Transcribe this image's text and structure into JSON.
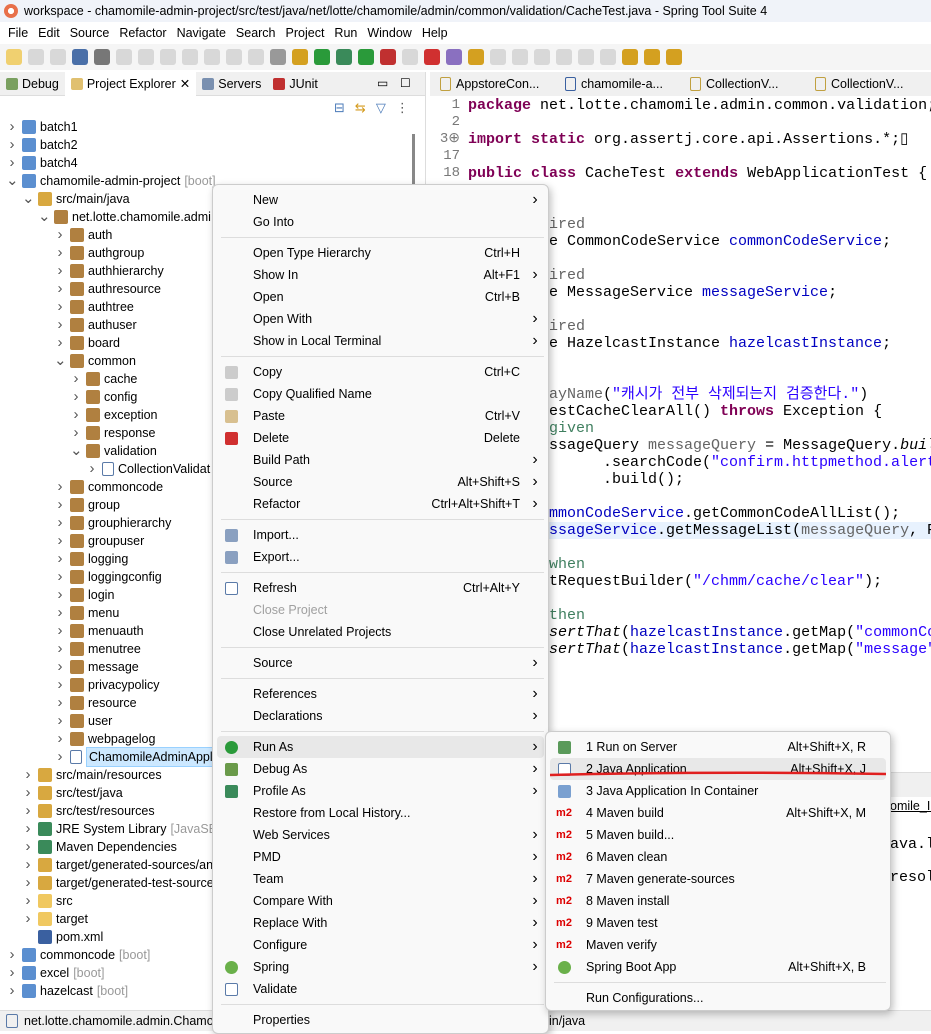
{
  "window": {
    "title": "workspace - chamomile-admin-project/src/test/java/net/lotte/chamomile/admin/common/validation/CacheTest.java - Spring Tool Suite 4"
  },
  "menubar": [
    "File",
    "Edit",
    "Source",
    "Refactor",
    "Navigate",
    "Search",
    "Project",
    "Run",
    "Window",
    "Help"
  ],
  "view_tabs": [
    {
      "label": "Debug",
      "icon": "bug-icon"
    },
    {
      "label": "Project Explorer",
      "icon": "project-explorer-icon",
      "active": true,
      "close": "✕"
    },
    {
      "label": "Servers",
      "icon": "servers-icon"
    },
    {
      "label": "JUnit",
      "icon": "junit-icon"
    }
  ],
  "tree": [
    {
      "label": "batch1",
      "level": 0,
      "arrow": ">",
      "icon": "maven-project"
    },
    {
      "label": "batch2",
      "level": 0,
      "arrow": ">",
      "icon": "maven-project"
    },
    {
      "label": "batch4",
      "level": 0,
      "arrow": ">",
      "icon": "maven-project"
    },
    {
      "label": "chamomile-admin-project",
      "sub": "[boot]",
      "level": 0,
      "arrow": "v",
      "icon": "maven-project"
    },
    {
      "label": "src/main/java",
      "level": 1,
      "arrow": "v",
      "icon": "source-folder"
    },
    {
      "label": "net.lotte.chamomile.admi",
      "level": 2,
      "arrow": "v",
      "icon": "package"
    },
    {
      "label": "auth",
      "level": 3,
      "arrow": ">",
      "icon": "package"
    },
    {
      "label": "authgroup",
      "level": 3,
      "arrow": ">",
      "icon": "package"
    },
    {
      "label": "authhierarchy",
      "level": 3,
      "arrow": ">",
      "icon": "package"
    },
    {
      "label": "authresource",
      "level": 3,
      "arrow": ">",
      "icon": "package"
    },
    {
      "label": "authtree",
      "level": 3,
      "arrow": ">",
      "icon": "package"
    },
    {
      "label": "authuser",
      "level": 3,
      "arrow": ">",
      "icon": "package"
    },
    {
      "label": "board",
      "level": 3,
      "arrow": ">",
      "icon": "package"
    },
    {
      "label": "common",
      "level": 3,
      "arrow": "v",
      "icon": "package"
    },
    {
      "label": "cache",
      "level": 4,
      "arrow": ">",
      "icon": "package"
    },
    {
      "label": "config",
      "level": 4,
      "arrow": ">",
      "icon": "package"
    },
    {
      "label": "exception",
      "level": 4,
      "arrow": ">",
      "icon": "package"
    },
    {
      "label": "response",
      "level": 4,
      "arrow": ">",
      "icon": "package"
    },
    {
      "label": "validation",
      "level": 4,
      "arrow": "v",
      "icon": "package"
    },
    {
      "label": "CollectionValidat",
      "level": 5,
      "arrow": ">",
      "icon": "java-file"
    },
    {
      "label": "commoncode",
      "level": 3,
      "arrow": ">",
      "icon": "package"
    },
    {
      "label": "group",
      "level": 3,
      "arrow": ">",
      "icon": "package"
    },
    {
      "label": "grouphierarchy",
      "level": 3,
      "arrow": ">",
      "icon": "package"
    },
    {
      "label": "groupuser",
      "level": 3,
      "arrow": ">",
      "icon": "package"
    },
    {
      "label": "logging",
      "level": 3,
      "arrow": ">",
      "icon": "package"
    },
    {
      "label": "loggingconfig",
      "level": 3,
      "arrow": ">",
      "icon": "package"
    },
    {
      "label": "login",
      "level": 3,
      "arrow": ">",
      "icon": "package"
    },
    {
      "label": "menu",
      "level": 3,
      "arrow": ">",
      "icon": "package"
    },
    {
      "label": "menuauth",
      "level": 3,
      "arrow": ">",
      "icon": "package"
    },
    {
      "label": "menutree",
      "level": 3,
      "arrow": ">",
      "icon": "package"
    },
    {
      "label": "message",
      "level": 3,
      "arrow": ">",
      "icon": "package"
    },
    {
      "label": "privacypolicy",
      "level": 3,
      "arrow": ">",
      "icon": "package"
    },
    {
      "label": "resource",
      "level": 3,
      "arrow": ">",
      "icon": "package"
    },
    {
      "label": "user",
      "level": 3,
      "arrow": ">",
      "icon": "package"
    },
    {
      "label": "webpagelog",
      "level": 3,
      "arrow": ">",
      "icon": "package"
    },
    {
      "label": "ChamomileAdminAppl",
      "level": 3,
      "arrow": ">",
      "icon": "java-file",
      "selected": true
    },
    {
      "label": "src/main/resources",
      "level": 1,
      "arrow": ">",
      "icon": "source-folder"
    },
    {
      "label": "src/test/java",
      "level": 1,
      "arrow": ">",
      "icon": "source-folder"
    },
    {
      "label": "src/test/resources",
      "level": 1,
      "arrow": ">",
      "icon": "source-folder"
    },
    {
      "label": "JRE System Library",
      "sub": "[JavaSE-1",
      "level": 1,
      "arrow": ">",
      "icon": "library"
    },
    {
      "label": "Maven Dependencies",
      "level": 1,
      "arrow": ">",
      "icon": "library"
    },
    {
      "label": "target/generated-sources/ann",
      "level": 1,
      "arrow": ">",
      "icon": "source-folder"
    },
    {
      "label": "target/generated-test-source",
      "level": 1,
      "arrow": ">",
      "icon": "source-folder"
    },
    {
      "label": "src",
      "level": 1,
      "arrow": ">",
      "icon": "folder"
    },
    {
      "label": "target",
      "level": 1,
      "arrow": ">",
      "icon": "folder"
    },
    {
      "label": "pom.xml",
      "level": 1,
      "arrow": "",
      "icon": "maven-pom"
    },
    {
      "label": "commoncode",
      "sub": "[boot]",
      "level": 0,
      "arrow": ">",
      "icon": "maven-project"
    },
    {
      "label": "excel",
      "sub": "[boot]",
      "level": 0,
      "arrow": ">",
      "icon": "maven-project"
    },
    {
      "label": "hazelcast",
      "sub": "[boot]",
      "level": 0,
      "arrow": ">",
      "icon": "maven-project"
    }
  ],
  "editor_tabs": [
    "AppstoreCon...",
    "chamomile-a...",
    "CollectionV...",
    "CollectionV..."
  ],
  "code": [
    {
      "ln": "1",
      "html": "<span class='kw'>package</span> net.lotte.chamomile.admin.common.validation;"
    },
    {
      "ln": "2",
      "html": ""
    },
    {
      "ln": "3⊕",
      "html": "<span class='kw'>import</span> <span class='kw'>static</span> org.assertj.core.api.Assertions.*;▯"
    },
    {
      "ln": "17",
      "html": ""
    },
    {
      "ln": "18",
      "html": "<span class='kw'>public</span> <span class='kw'>class</span> CacheTest <span class='kw'>extends</span> WebApplicationTest {"
    }
  ],
  "code_fragments": [
    {
      "row": 2,
      "html": "<span class='an'>ired</span>"
    },
    {
      "row": 3,
      "html": "e CommonCodeService <span class='fld'>commonCodeService</span>;"
    },
    {
      "row": 5,
      "html": "<span class='an'>ired</span>"
    },
    {
      "row": 6,
      "html": "e MessageService <span class='fld'>messageService</span>;"
    },
    {
      "row": 8,
      "html": "<span class='an'>ired</span>"
    },
    {
      "row": 9,
      "html": "e HazelcastInstance <span class='fld'>hazelcastInstance</span>;"
    },
    {
      "row": 12,
      "html": "<span class='an'>ayName</span>(<span class='str'>\"캐시가 전부 삭제되는지 검증한다.\"</span>)"
    },
    {
      "row": 13,
      "html": "estCacheClearAll() <span class='kw'>throws</span> Exception {"
    },
    {
      "row": 14,
      "html": "<span class='cm'>given</span>"
    },
    {
      "row": 15,
      "html": "ssageQuery <span class='an'>messageQuery</span> = MessageQuery.<span class='it'>builder</span>()"
    },
    {
      "row": 16,
      "html": "      .searchCode(<span class='str'>\"confirm.httpmethod.alert\"</span>)"
    },
    {
      "row": 17,
      "html": "      .build();"
    },
    {
      "row": 19,
      "html": "<span class='fld'>mmonCodeService</span>.getCommonCodeAllList();"
    },
    {
      "row": 20,
      "html": "<span class='fld'>ssageService</span>.getMessageList(<span class='an'>messageQuery</span>, PageRe"
    },
    {
      "row": 22,
      "html": "<span class='cm'>when</span>"
    },
    {
      "row": 23,
      "html": "tRequestBuilder(<span class='str'>\"/chmm/cache/clear\"</span>);"
    },
    {
      "row": 25,
      "html": "<span class='cm'>then</span>"
    },
    {
      "row": 26,
      "html": "<span class='it'>sertThat</span>(<span class='fld'>hazelcastInstance</span>.getMap(<span class='str'>\"commonCode\"</span>)."
    },
    {
      "row": 27,
      "html": "<span class='it'>sertThat</span>(<span class='fld'>hazelcastInstance</span>.getMap(<span class='str'>\"message\"</span>).isE"
    }
  ],
  "bottom_panel": {
    "tab_fragment": "omile_II",
    "line1": "ava.la",
    "line2": "resol"
  },
  "statusbar": {
    "left": "net.lotte.chamomile.admin.Chamo",
    "right": "in/java"
  },
  "context_menu": [
    {
      "label": "New",
      "submenu": true
    },
    {
      "label": "Go Into"
    },
    {
      "sep": true
    },
    {
      "label": "Open Type Hierarchy",
      "shortcut": "Ctrl+H"
    },
    {
      "label": "Show In",
      "shortcut": "Alt+F1",
      "submenu": true
    },
    {
      "label": "Open",
      "shortcut": "Ctrl+B"
    },
    {
      "label": "Open With",
      "submenu": true
    },
    {
      "label": "Show in Local Terminal",
      "submenu": true
    },
    {
      "sep": true
    },
    {
      "label": "Copy",
      "shortcut": "Ctrl+C",
      "icon": "copy-icon"
    },
    {
      "label": "Copy Qualified Name",
      "icon": "copy-icon"
    },
    {
      "label": "Paste",
      "shortcut": "Ctrl+V",
      "icon": "paste-icon"
    },
    {
      "label": "Delete",
      "shortcut": "Delete",
      "icon": "delete-icon"
    },
    {
      "label": "Build Path",
      "submenu": true
    },
    {
      "label": "Source",
      "shortcut": "Alt+Shift+S",
      "submenu": true
    },
    {
      "label": "Refactor",
      "shortcut": "Ctrl+Alt+Shift+T",
      "submenu": true
    },
    {
      "sep": true
    },
    {
      "label": "Import...",
      "icon": "import-icon"
    },
    {
      "label": "Export...",
      "icon": "export-icon"
    },
    {
      "sep": true
    },
    {
      "label": "Refresh",
      "shortcut": "Ctrl+Alt+Y",
      "icon": "refresh-icon"
    },
    {
      "label": "Close Project",
      "disabled": true
    },
    {
      "label": "Close Unrelated Projects"
    },
    {
      "sep": true
    },
    {
      "label": "Source",
      "submenu": true
    },
    {
      "sep": true
    },
    {
      "label": "References",
      "submenu": true
    },
    {
      "label": "Declarations",
      "submenu": true
    },
    {
      "sep": true
    },
    {
      "label": "Run As",
      "submenu": true,
      "icon": "run-icon",
      "highlighted": true
    },
    {
      "label": "Debug As",
      "submenu": true,
      "icon": "debug-icon"
    },
    {
      "label": "Profile As",
      "submenu": true,
      "icon": "profile-icon"
    },
    {
      "label": "Restore from Local History..."
    },
    {
      "label": "Web Services",
      "submenu": true
    },
    {
      "label": "PMD",
      "submenu": true
    },
    {
      "label": "Team",
      "submenu": true
    },
    {
      "label": "Compare With",
      "submenu": true
    },
    {
      "label": "Replace With",
      "submenu": true
    },
    {
      "label": "Configure",
      "submenu": true
    },
    {
      "label": "Spring",
      "submenu": true,
      "icon": "spring-icon"
    },
    {
      "label": "Validate",
      "icon": "validate-icon"
    },
    {
      "sep": true
    },
    {
      "label": "Properties"
    }
  ],
  "run_as_menu": [
    {
      "label": "1 Run on Server",
      "shortcut": "Alt+Shift+X, R",
      "icon": "run-on-server-icon"
    },
    {
      "label": "2 Java Application",
      "shortcut": "Alt+Shift+X, J",
      "icon": "java-app-icon",
      "highlighted": true
    },
    {
      "label": "3 Java Application In Container",
      "icon": "container-icon"
    },
    {
      "label": "4 Maven build",
      "shortcut": "Alt+Shift+X, M",
      "icon": "m2"
    },
    {
      "label": "5 Maven build...",
      "icon": "m2"
    },
    {
      "label": "6 Maven clean",
      "icon": "m2"
    },
    {
      "label": "7 Maven generate-sources",
      "icon": "m2"
    },
    {
      "label": "8 Maven install",
      "icon": "m2"
    },
    {
      "label": "9 Maven test",
      "icon": "m2"
    },
    {
      "label": "Maven verify",
      "icon": "m2"
    },
    {
      "label": "Spring Boot App",
      "shortcut": "Alt+Shift+X, B",
      "icon": "spring-icon"
    },
    {
      "sep": true
    },
    {
      "label": "Run Configurations..."
    }
  ],
  "colors": {
    "annotation_underline": "#e02020",
    "selection": "#cce8ff",
    "menu_highlight": "#e8e8e8",
    "current_line": "#e8f2fe"
  }
}
